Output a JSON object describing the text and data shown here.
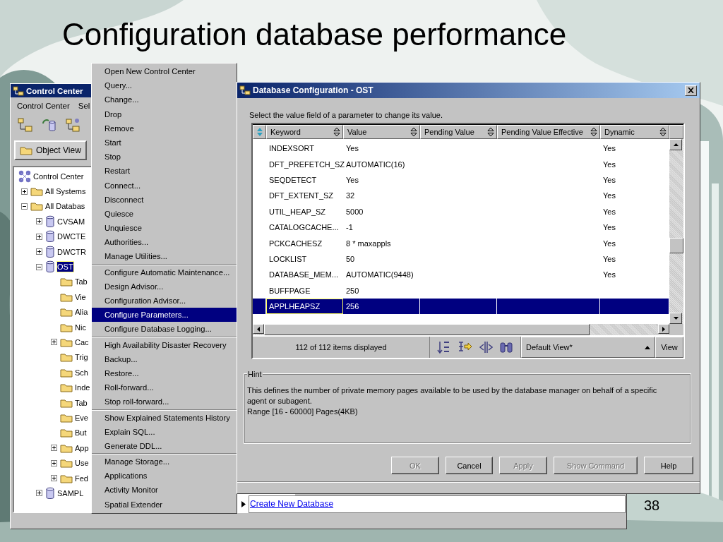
{
  "slide": {
    "title": "Configuration database performance",
    "page_number": "38"
  },
  "control_center": {
    "title": "Control Center",
    "menu": [
      {
        "label": "Control Center"
      },
      {
        "label": "Sel"
      }
    ],
    "view_tab": "Object View",
    "tree": [
      {
        "kind": "root",
        "label": "Control Center",
        "selected": false,
        "children": [
          {
            "kind": "folder",
            "label": "All Systems",
            "selected": false,
            "expanded": false
          },
          {
            "kind": "folder",
            "label": "All Databas",
            "selected": false,
            "expanded": true,
            "children": [
              {
                "kind": "database",
                "label": "CVSAM",
                "selected": false,
                "expanded": false
              },
              {
                "kind": "database",
                "label": "DWCTE",
                "selected": false,
                "expanded": false
              },
              {
                "kind": "database",
                "label": "DWCTR",
                "selected": false,
                "expanded": false
              },
              {
                "kind": "database",
                "label": "OST",
                "selected": true,
                "expanded": true,
                "children": [
                  {
                    "kind": "folder",
                    "label": "Tab",
                    "selected": false
                  },
                  {
                    "kind": "folder",
                    "label": "Vie",
                    "selected": false
                  },
                  {
                    "kind": "folder",
                    "label": "Alia",
                    "selected": false
                  },
                  {
                    "kind": "folder",
                    "label": "Nic",
                    "selected": false
                  },
                  {
                    "kind": "folder",
                    "label": "Cac",
                    "selected": false,
                    "expanded": false
                  },
                  {
                    "kind": "folder",
                    "label": "Trig",
                    "selected": false
                  },
                  {
                    "kind": "folder",
                    "label": "Sch",
                    "selected": false
                  },
                  {
                    "kind": "folder",
                    "label": "Inde",
                    "selected": false
                  },
                  {
                    "kind": "folder",
                    "label": "Tab",
                    "selected": false
                  },
                  {
                    "kind": "folder",
                    "label": "Eve",
                    "selected": false
                  },
                  {
                    "kind": "folder",
                    "label": "But",
                    "selected": false
                  },
                  {
                    "kind": "folder",
                    "label": "App",
                    "selected": false,
                    "expanded": false
                  },
                  {
                    "kind": "folder",
                    "label": "Use",
                    "selected": false,
                    "expanded": false
                  },
                  {
                    "kind": "folder",
                    "label": "Fed",
                    "selected": false,
                    "expanded": false
                  }
                ]
              },
              {
                "kind": "database",
                "label": "SAMPL",
                "selected": false,
                "expanded": false
              }
            ]
          }
        ]
      }
    ],
    "link": "Create New Database"
  },
  "context_menu": {
    "groups": [
      [
        {
          "label": "Open New Control Center",
          "selected": false
        },
        {
          "label": "Query...",
          "selected": false
        },
        {
          "label": "Change...",
          "selected": false
        },
        {
          "label": "Drop",
          "selected": false
        },
        {
          "label": "Remove",
          "selected": false
        },
        {
          "label": "Start",
          "selected": false
        },
        {
          "label": "Stop",
          "selected": false
        },
        {
          "label": "Restart",
          "selected": false
        },
        {
          "label": "Connect...",
          "selected": false
        },
        {
          "label": "Disconnect",
          "selected": false
        },
        {
          "label": "Quiesce",
          "selected": false
        },
        {
          "label": "Unquiesce",
          "selected": false
        },
        {
          "label": "Authorities...",
          "selected": false
        },
        {
          "label": "Manage Utilities...",
          "selected": false
        }
      ],
      [
        {
          "label": "Configure Automatic Maintenance...",
          "selected": false
        },
        {
          "label": "Design Advisor...",
          "selected": false
        },
        {
          "label": "Configuration Advisor...",
          "selected": false
        },
        {
          "label": "Configure Parameters...",
          "selected": true
        },
        {
          "label": "Configure Database Logging...",
          "selected": false
        }
      ],
      [
        {
          "label": "High Availability Disaster Recovery",
          "selected": false
        },
        {
          "label": "Backup...",
          "selected": false
        },
        {
          "label": "Restore...",
          "selected": false
        },
        {
          "label": "Roll-forward...",
          "selected": false
        },
        {
          "label": "Stop roll-forward...",
          "selected": false
        }
      ],
      [
        {
          "label": "Show Explained Statements History",
          "selected": false
        },
        {
          "label": "Explain SQL...",
          "selected": false
        },
        {
          "label": "Generate DDL...",
          "selected": false
        }
      ],
      [
        {
          "label": "Manage Storage...",
          "selected": false
        },
        {
          "label": "Applications",
          "selected": false
        },
        {
          "label": "Activity Monitor",
          "selected": false
        },
        {
          "label": "Spatial Extender",
          "selected": false
        }
      ]
    ]
  },
  "dialog": {
    "title": "Database Configuration - OST",
    "instruction": "Select the value field of a parameter to change its value.",
    "columns": [
      "Keyword",
      "Value",
      "Pending Value",
      "Pending Value Effective",
      "Dynamic"
    ],
    "rows": [
      {
        "keyword": "INDEXSORT",
        "value": "Yes",
        "dynamic": "Yes",
        "selected": false
      },
      {
        "keyword": "DFT_PREFETCH_SZ",
        "value": "AUTOMATIC(16)",
        "dynamic": "Yes",
        "selected": false
      },
      {
        "keyword": "SEQDETECT",
        "value": "Yes",
        "dynamic": "Yes",
        "selected": false
      },
      {
        "keyword": "DFT_EXTENT_SZ",
        "value": "32",
        "dynamic": "Yes",
        "selected": false
      },
      {
        "keyword": "UTIL_HEAP_SZ",
        "value": "5000",
        "dynamic": "Yes",
        "selected": false
      },
      {
        "keyword": "CATALOGCACHE...",
        "value": "-1",
        "dynamic": "Yes",
        "selected": false
      },
      {
        "keyword": "PCKCACHESZ",
        "value": "8 * maxappls",
        "dynamic": "Yes",
        "selected": false
      },
      {
        "keyword": "LOCKLIST",
        "value": "50",
        "dynamic": "Yes",
        "selected": false
      },
      {
        "keyword": "DATABASE_MEM...",
        "value": "AUTOMATIC(9448)",
        "dynamic": "Yes",
        "selected": false
      },
      {
        "keyword": "BUFFPAGE",
        "value": "250",
        "selected": false
      },
      {
        "keyword": "APPLHEAPSZ",
        "value": "256",
        "selected": true
      }
    ],
    "status": "112 of 112 items displayed",
    "view_select": "Default View*",
    "view_button": "View",
    "hint": {
      "label": "Hint",
      "text": "This defines the number of private memory pages available to be used by the database manager on behalf of a specific agent or subagent.",
      "range": "Range [16 - 60000] Pages(4KB)"
    },
    "buttons": [
      {
        "label": "OK",
        "disabled": true
      },
      {
        "label": "Cancel",
        "disabled": false
      },
      {
        "label": "Apply",
        "disabled": true
      },
      {
        "label": "Show Command",
        "disabled": true
      },
      {
        "label": "Help",
        "disabled": false
      }
    ]
  }
}
